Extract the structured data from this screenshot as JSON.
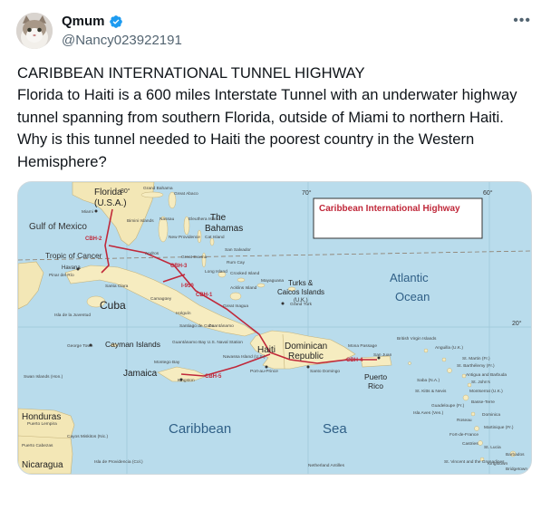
{
  "author": {
    "name": "Qmum",
    "handle": "@Nancy023922191",
    "verified": true
  },
  "menu": {
    "more_label": "•••"
  },
  "tweet": {
    "title": "CARIBBEAN INTERNATIONAL TUNNEL HIGHWAY",
    "body": "Florida to Haiti is a 600 miles Interstate Tunnel with an underwater highway tunnel spanning from southern Florida, outside of Miami to northern Haiti. Why is this tunnel needed to Haiti the poorest country in the Western Hemisphere?"
  },
  "map": {
    "banner": "Caribbean International Highway",
    "regions": {
      "florida": "Florida",
      "florida_usa": "(U.S.A.)",
      "gulf": "Gulf of Mexico",
      "bahamas_the": "The",
      "bahamas": "Bahamas",
      "tropic": "Tropic of Cancer",
      "cuba": "Cuba",
      "havana": "Havana",
      "atlantic": "Atlantic",
      "ocean": "Ocean",
      "turks": "Turks &",
      "caicos": "Caicos Islands",
      "uk": "(U.K.)",
      "haiti": "Haiti",
      "dominican": "Dominican",
      "republic": "Republic",
      "cayman": "Cayman Islands",
      "jamaica": "Jamaica",
      "puerto": "Puerto",
      "rico": "Rico",
      "caribbean": "Caribbean",
      "sea": "Sea",
      "honduras": "Honduras",
      "nicaragua": "Nicaragua",
      "lon70": "70°",
      "lon80": "80°",
      "lon60": "60°",
      "lat20": "20°"
    },
    "route_labels": {
      "cbh2": "CBH-2",
      "cbh3": "CBH-3",
      "cbh1": "CBH-1",
      "i950": "I-950",
      "cbh4": "CBH-4",
      "cbh5": "CBH-5"
    },
    "places": {
      "miami": "Miami",
      "grand_bahama": "Grand Bahama",
      "great_abaco": "Great Abaco",
      "bimini": "Bimini Islands",
      "nassau": "Nassau",
      "eleuthera": "Eleuthera Island",
      "new_providence": "New Providence",
      "cat_island": "Cat Island",
      "san_salvador": "San Salvador",
      "andros": "Andros",
      "great_exuma": "Great Exuma",
      "long_island": "Long Island",
      "rum_cay": "Rum Cay",
      "crooked_island": "Crooked Island",
      "acklins": "Acklins Island",
      "mayaguana": "Mayaguana",
      "great_inagua": "Great Inagua",
      "grand_turk": "Grand Turk",
      "pinar": "Pinar del Río",
      "santa_clara": "Santa Clara",
      "camaguey": "Camagüey",
      "holguin": "Holguín",
      "santiago": "Santiago de Cuba",
      "guantanamo": "Guantánamo",
      "guantanamo_bay": "Guantánamo Bay U.S. Naval Station",
      "isla_juventud": "Isla de la Juventud",
      "george_town": "George Town",
      "montego": "Montego Bay",
      "kingston": "Kingston",
      "navassa": "Navassa Island (U.S.)",
      "port_au_prince": "Port-au-Prince",
      "santo_domingo": "Santo Domingo",
      "mona": "Mona Passage",
      "san_juan": "San Juan",
      "virgin_islands": "British Virgin Islands",
      "anguilla": "Anguilla (U.K.)",
      "st_martin": "St. Martin (Fr.)",
      "st_barthelemy": "St. Barthélemy (Fr.)",
      "antigua": "Antigua and Barbuda",
      "st_johns": "St. John's",
      "montserrat": "Montserrat (U.K.)",
      "guadeloupe": "Guadeloupe (Fr.)",
      "basse_terre": "Basse-Terre",
      "dominica": "Dominica",
      "roseau": "Roseau",
      "martinique": "Martinique (Fr.)",
      "fort_de_france": "Fort-de-France",
      "st_lucia": "St. Lucia",
      "castries": "Castries",
      "barbados": "Barbados",
      "bridgetown": "Bridgetown",
      "st_vincent": "St. Vincent and the Grenadines",
      "kingstown": "Kingstown",
      "saba": "Saba (N.A.)",
      "st_kitts": "St. Kitts & Nevis",
      "swan": "Swan Islands (Hon.)",
      "cayos": "Cayos Miskitos (Nic.)",
      "puerto_cabezas": "Puerto Cabezas",
      "providencia": "Isla de Providencia (Col.)",
      "netherlands_antilles": "Netherland Antilles",
      "isla_aves": "Isla Aves (Ven.)",
      "puerto_lempira": "Puerto Lempira"
    }
  }
}
